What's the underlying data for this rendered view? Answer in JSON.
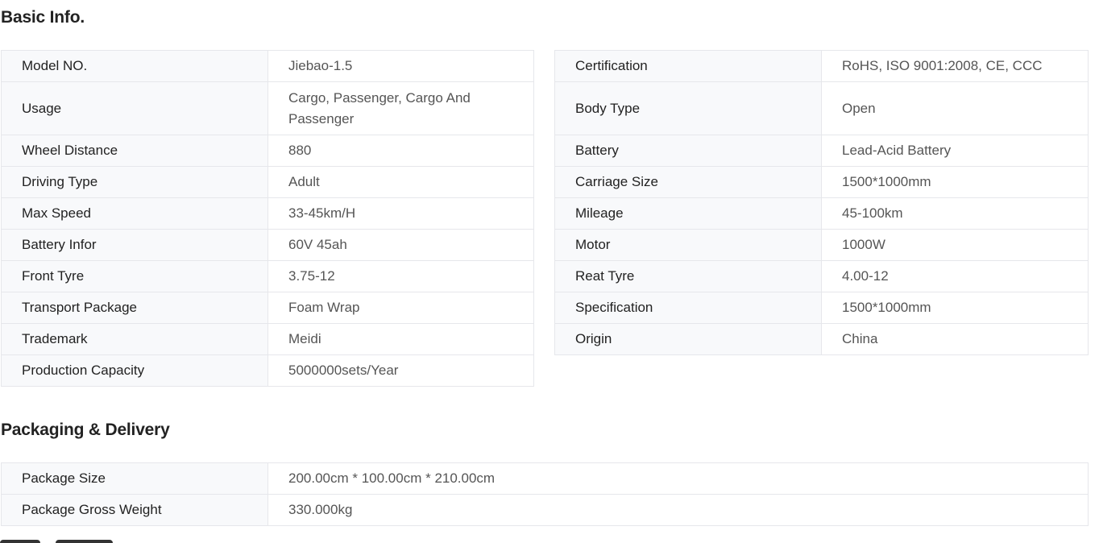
{
  "basic_info": {
    "title": "Basic Info.",
    "left_rows": [
      {
        "label": "Model NO.",
        "value": "Jiebao-1.5"
      },
      {
        "label": "Usage",
        "value": "Cargo, Passenger, Cargo And Passenger"
      },
      {
        "label": "Wheel Distance",
        "value": "880"
      },
      {
        "label": "Driving Type",
        "value": "Adult"
      },
      {
        "label": "Max Speed",
        "value": "33-45km/H"
      },
      {
        "label": "Battery Infor",
        "value": "60V 45ah"
      },
      {
        "label": "Front Tyre",
        "value": "3.75-12"
      },
      {
        "label": "Transport Package",
        "value": "Foam Wrap"
      },
      {
        "label": "Trademark",
        "value": "Meidi"
      },
      {
        "label": "Production Capacity",
        "value": "5000000sets/Year"
      }
    ],
    "right_rows": [
      {
        "label": "Certification",
        "value": "RoHS, ISO 9001:2008, CE, CCC"
      },
      {
        "label": "Body Type",
        "value": "Open"
      },
      {
        "label": "Battery",
        "value": "Lead-Acid Battery"
      },
      {
        "label": "Carriage Size",
        "value": "1500*1000mm"
      },
      {
        "label": "Mileage",
        "value": "45-100km"
      },
      {
        "label": "Motor",
        "value": "1000W"
      },
      {
        "label": "Reat Tyre",
        "value": "4.00-12"
      },
      {
        "label": "Specification",
        "value": "1500*1000mm"
      },
      {
        "label": "Origin",
        "value": "China"
      }
    ]
  },
  "packaging": {
    "title": "Packaging & Delivery",
    "rows": [
      {
        "label": "Package Size",
        "value": "200.00cm * 100.00cm * 210.00cm"
      },
      {
        "label": "Package Gross Weight",
        "value": "330.000kg"
      }
    ]
  }
}
